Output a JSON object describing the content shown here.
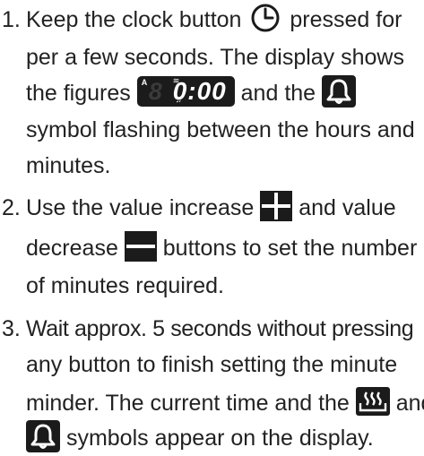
{
  "steps": [
    {
      "number": "1.",
      "lines": {
        "l1a": "Keep the clock button",
        "l1b": "pressed for",
        "l2": "per a few seconds. The display shows",
        "l3a": "the figures",
        "l3b": "and the",
        "l4": "symbol flashing between the hours and",
        "l5": "minutes."
      }
    },
    {
      "number": "2.",
      "lines": {
        "l1a": "Use the value increase",
        "l1b": "and value",
        "l2a": "decrease",
        "l2b": "buttons to set the number",
        "l3": "of minutes required."
      }
    },
    {
      "number": "3.",
      "lines": {
        "l1": "Wait approx. 5 seconds without pressing",
        "l2": "any button to finish setting the minute",
        "l3a": "minder. The current time and the",
        "l3b": "and",
        "l4": "symbols appear on the display."
      }
    }
  ],
  "display": {
    "indicator": "A",
    "dim_digit": "8",
    "digits": "0:00"
  },
  "icons": {
    "clock": "clock-icon",
    "display": "display-icon",
    "bell": "bell-icon",
    "plus": "plus-icon",
    "minus": "minus-icon",
    "heat": "heat-icon"
  },
  "colors": {
    "text": "#222222",
    "icon_bg": "#1b1b1b",
    "icon_fg": "#ffffff"
  }
}
